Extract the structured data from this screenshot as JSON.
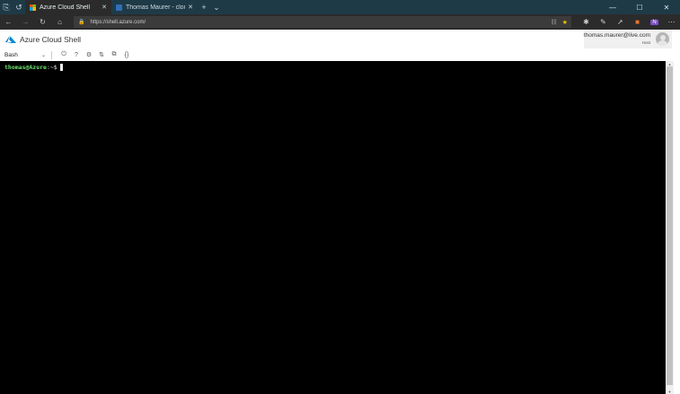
{
  "browser": {
    "tabs": [
      {
        "label": "Azure Cloud Shell",
        "active": true
      },
      {
        "label": "Thomas Maurer - cloud and",
        "active": false
      }
    ],
    "url": "https://shell.azure.com/"
  },
  "header": {
    "title": "Azure Cloud Shell",
    "account_email": "thomas.maurer@live.com",
    "account_tenant": "Host"
  },
  "toolbar": {
    "shell_type": "Bash"
  },
  "terminal": {
    "prompt_user": "thomas@Azure",
    "prompt_path": ":~$"
  },
  "colors": {
    "tabstrip": "#1f3a47",
    "chrome": "#2b2b2b",
    "azure_blue": "#0072c6",
    "prompt_green": "#6ee26e"
  }
}
